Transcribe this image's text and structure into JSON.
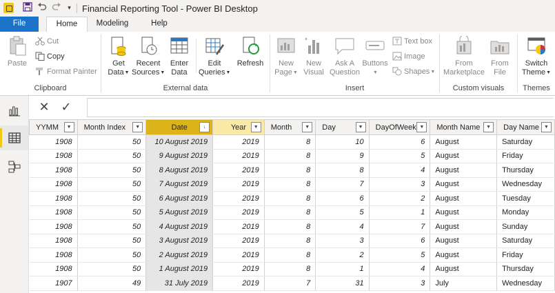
{
  "window": {
    "title": "Financial Reporting Tool - Power BI Desktop"
  },
  "tabs": {
    "file": "File",
    "home": "Home",
    "modeling": "Modeling",
    "help": "Help"
  },
  "ribbon": {
    "clipboard": {
      "label": "Clipboard",
      "paste": "Paste",
      "cut": "Cut",
      "copy": "Copy",
      "format_painter": "Format Painter"
    },
    "external_data": {
      "label": "External data",
      "get_data": [
        "Get",
        "Data"
      ],
      "recent_sources": [
        "Recent",
        "Sources"
      ],
      "enter_data": [
        "Enter",
        "Data"
      ],
      "edit_queries": [
        "Edit",
        "Queries"
      ],
      "refresh": "Refresh"
    },
    "insert": {
      "label": "Insert",
      "new_page": [
        "New",
        "Page"
      ],
      "new_visual": [
        "New",
        "Visual"
      ],
      "ask_question": [
        "Ask A",
        "Question"
      ],
      "buttons": "Buttons",
      "text_box": "Text box",
      "image": "Image",
      "shapes": "Shapes"
    },
    "custom_visuals": {
      "label": "Custom visuals",
      "from_marketplace": [
        "From",
        "Marketplace"
      ],
      "from_file": [
        "From",
        "File"
      ]
    },
    "themes": {
      "label": "Themes",
      "switch_theme": [
        "Switch",
        "Theme"
      ]
    }
  },
  "table": {
    "columns": [
      "YYMM",
      "Month Index",
      "Date",
      "Year",
      "Month",
      "Day",
      "DayOfWeek",
      "Month Name",
      "Day Name"
    ],
    "rows": [
      [
        "1908",
        "50",
        "10 August 2019",
        "2019",
        "8",
        "10",
        "6",
        "August",
        "Saturday"
      ],
      [
        "1908",
        "50",
        "9 August 2019",
        "2019",
        "8",
        "9",
        "5",
        "August",
        "Friday"
      ],
      [
        "1908",
        "50",
        "8 August 2019",
        "2019",
        "8",
        "8",
        "4",
        "August",
        "Thursday"
      ],
      [
        "1908",
        "50",
        "7 August 2019",
        "2019",
        "8",
        "7",
        "3",
        "August",
        "Wednesday"
      ],
      [
        "1908",
        "50",
        "6 August 2019",
        "2019",
        "8",
        "6",
        "2",
        "August",
        "Tuesday"
      ],
      [
        "1908",
        "50",
        "5 August 2019",
        "2019",
        "8",
        "5",
        "1",
        "August",
        "Monday"
      ],
      [
        "1908",
        "50",
        "4 August 2019",
        "2019",
        "8",
        "4",
        "7",
        "August",
        "Sunday"
      ],
      [
        "1908",
        "50",
        "3 August 2019",
        "2019",
        "8",
        "3",
        "6",
        "August",
        "Saturday"
      ],
      [
        "1908",
        "50",
        "2 August 2019",
        "2019",
        "8",
        "2",
        "5",
        "August",
        "Friday"
      ],
      [
        "1908",
        "50",
        "1 August 2019",
        "2019",
        "8",
        "1",
        "4",
        "August",
        "Thursday"
      ],
      [
        "1907",
        "49",
        "31 July 2019",
        "2019",
        "7",
        "31",
        "3",
        "July",
        "Wednesday"
      ]
    ]
  },
  "colors": {
    "accent": "#f2c811",
    "file_tab": "#1a73c8",
    "selected_header": "#dcb41a",
    "highlight_header": "#fbe9a6"
  }
}
